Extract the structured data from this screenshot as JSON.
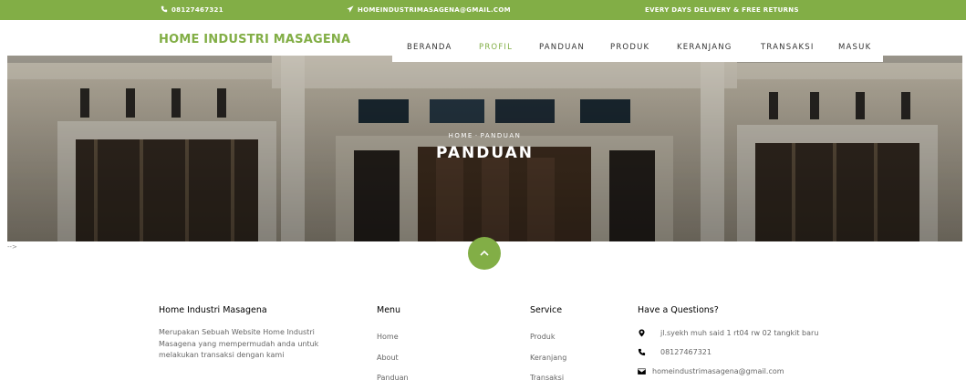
{
  "topbar": {
    "phone": "08127467321",
    "email": "HOMEINDUSTRIMASAGENA@GMAIL.COM",
    "delivery": "EVERY DAYS DELIVERY & FREE RETURNS"
  },
  "brand": "HOME INDUSTRI MASAGENA",
  "nav": {
    "items": [
      {
        "label": "BERANDA"
      },
      {
        "label": "PROFIL"
      },
      {
        "label": "PANDUAN"
      },
      {
        "label": "PRODUK"
      },
      {
        "label": "KERANJANG"
      },
      {
        "label": "TRANSAKSI"
      },
      {
        "label": "MASUK"
      }
    ]
  },
  "hero": {
    "breadcrumb_home": "HOME",
    "breadcrumb_current": "PANDUAN",
    "title": "PANDUAN"
  },
  "stray_text": "-->",
  "footer": {
    "about": {
      "heading": "Home Industri Masagena",
      "text": "Merupakan Sebuah Website Home Industri Masagena yang mempermudah anda untuk melakukan transaksi dengan kami"
    },
    "menu": {
      "heading": "Menu",
      "items": [
        "Home",
        "About",
        "Panduan"
      ]
    },
    "service": {
      "heading": "Service",
      "items": [
        "Produk",
        "Keranjang",
        "Transaksi"
      ]
    },
    "contact": {
      "heading": "Have a Questions?",
      "address": "jl.syekh muh said 1 rt04 rw 02 tangkit baru",
      "phone": "08127467321",
      "email": "homeindustrimasagena@gmail.com"
    }
  },
  "colors": {
    "accent": "#82ae46"
  },
  "icons": [
    "phone-icon",
    "paper-plane-icon",
    "map-marker-icon",
    "envelope-icon",
    "chevron-up-icon"
  ]
}
